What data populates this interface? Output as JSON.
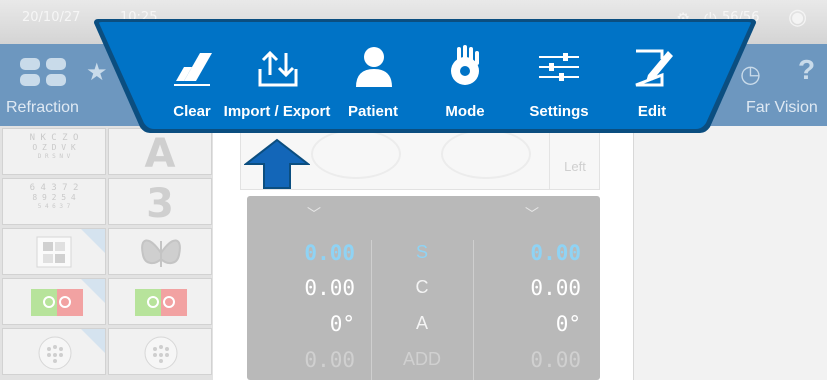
{
  "top_bar": {
    "date": "20/10/27",
    "time": "10:25",
    "right_status": "56/56"
  },
  "nav": {
    "left_tab_label": "Refraction",
    "right_tab_label": "Far Vision",
    "help_glyph": "?"
  },
  "chart_tiles": {
    "letters_row1": "N K C Z O",
    "letters_row2": "O Z D V K",
    "letters_row3": "D R S N V",
    "numbers_row1": "6 4 3 7 2",
    "numbers_row2": "8 9 2 5 4",
    "numbers_row3": "5 4 6 3 7",
    "big_letter": "A",
    "big_number": "3",
    "color_test_left": "30 O3",
    "color_test_right": "30 O3"
  },
  "eye_panel": {
    "left_label": "Left"
  },
  "refraction": {
    "rows": [
      {
        "label": "S",
        "right": "0.00",
        "left": "0.00"
      },
      {
        "label": "C",
        "right": "0.00",
        "left": "0.00"
      },
      {
        "label": "A",
        "right": "0°",
        "left": "0°"
      },
      {
        "label": "ADD",
        "right": "0.00",
        "left": "0.00"
      }
    ]
  },
  "menu": {
    "items": [
      {
        "label": "Clear",
        "icon": "eraser-icon"
      },
      {
        "label": "Import / Export",
        "icon": "import-export-icon"
      },
      {
        "label": "Patient",
        "icon": "person-icon"
      },
      {
        "label": "Mode",
        "icon": "hand-gear-icon"
      },
      {
        "label": "Settings",
        "icon": "sliders-icon"
      },
      {
        "label": "Edit",
        "icon": "edit-icon"
      }
    ]
  },
  "colors": {
    "menu_bg": "#0072c6",
    "menu_edge": "#0b4e80",
    "highlight_value": "#8fd3f4",
    "arrow": "#1366b8"
  }
}
